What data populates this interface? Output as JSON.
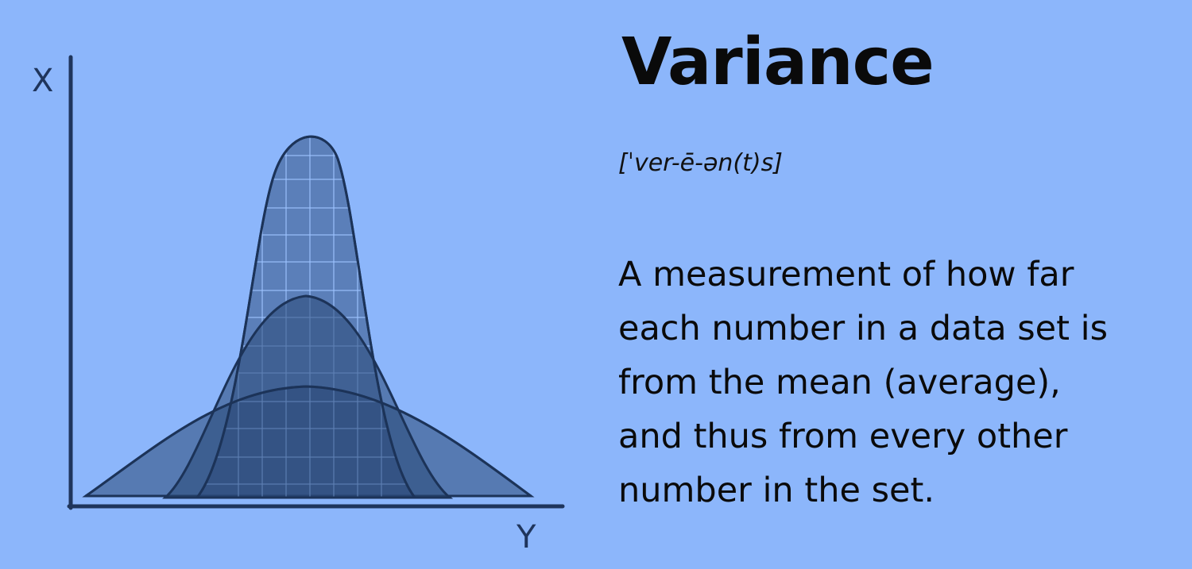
{
  "illustration": {
    "axis_x_label": "X",
    "axis_y_label": "Y",
    "colors": {
      "background": "#8cb6fb",
      "axis": "#1f355c",
      "curve_outline": "#1c3358",
      "curve_fill": "#2a4877",
      "grid_line": "#9ec3ff"
    },
    "curves": [
      "narrow-bell-curve",
      "medium-bell-curve",
      "wide-bell-curve"
    ]
  },
  "title": "Variance",
  "pronunciation": "[ˈver-ē-ən(t)s]",
  "definition": "A measurement of how far\neach number in a data set is\nfrom the mean (average),\nand thus from every other\nnumber in the set."
}
